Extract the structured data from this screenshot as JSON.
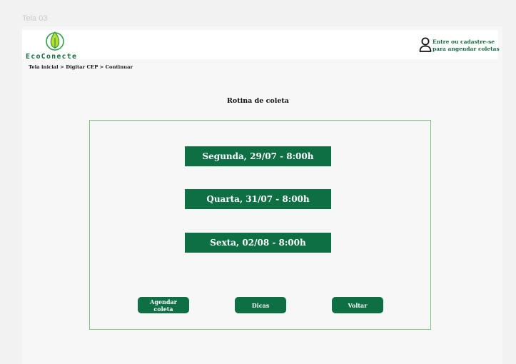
{
  "frame_label": "Tela 03",
  "brand": {
    "name": "EcoConecte",
    "icon": "leaf-logo-icon"
  },
  "header": {
    "login_line1": "Entre ou cadastre-se",
    "login_line2": "para angendar coletas",
    "user_icon": "user-icon"
  },
  "breadcrumb": "Tela inicial  > Digitar  CEP > Continuar",
  "page_title": "Rotina de coleta",
  "schedule": [
    {
      "label": "Segunda, 29/07  - 8:00h"
    },
    {
      "label": "Quarta, 31/07  - 8:00h"
    },
    {
      "label": "Sexta, 02/08  - 8:00h"
    }
  ],
  "actions": {
    "schedule": "Agendar coleta",
    "tips": "Dicas",
    "back": "Voltar"
  },
  "colors": {
    "primary": "#0e6f44",
    "brand_text": "#146c3a",
    "panel_border": "#7bc47b",
    "logo_circle": "#2f9e44",
    "logo_leaf": "#b7dd2f"
  }
}
